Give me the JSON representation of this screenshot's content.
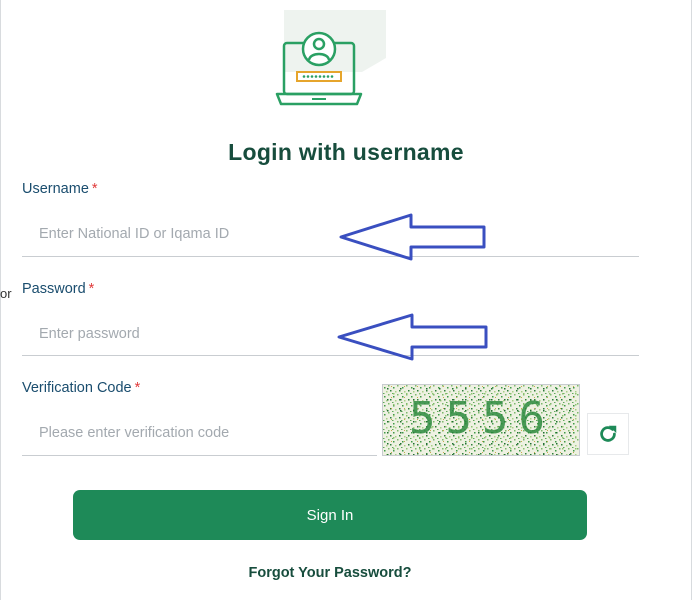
{
  "title": "Login with username",
  "stray_text": "or",
  "username": {
    "label": "Username",
    "required_mark": "*",
    "placeholder": "Enter National ID or Iqama ID",
    "value": ""
  },
  "password": {
    "label": "Password",
    "required_mark": "*",
    "placeholder": "Enter password",
    "value": ""
  },
  "verification": {
    "label": "Verification Code",
    "required_mark": "*",
    "placeholder": "Please enter verification code",
    "value": "",
    "captcha_text": "5556"
  },
  "signin_label": "Sign In",
  "forgot_label": "Forgot Your Password?",
  "icons": {
    "logo": "laptop-user-login-icon",
    "refresh": "refresh-icon",
    "annotation": "arrow-left-icon"
  },
  "colors": {
    "primary": "#1e8a58",
    "title": "#174d3d",
    "label": "#1a4d6e",
    "required": "#e03a3a",
    "logo_accent": "#e6a52c",
    "annotation_arrow": "#3a4fc0"
  }
}
